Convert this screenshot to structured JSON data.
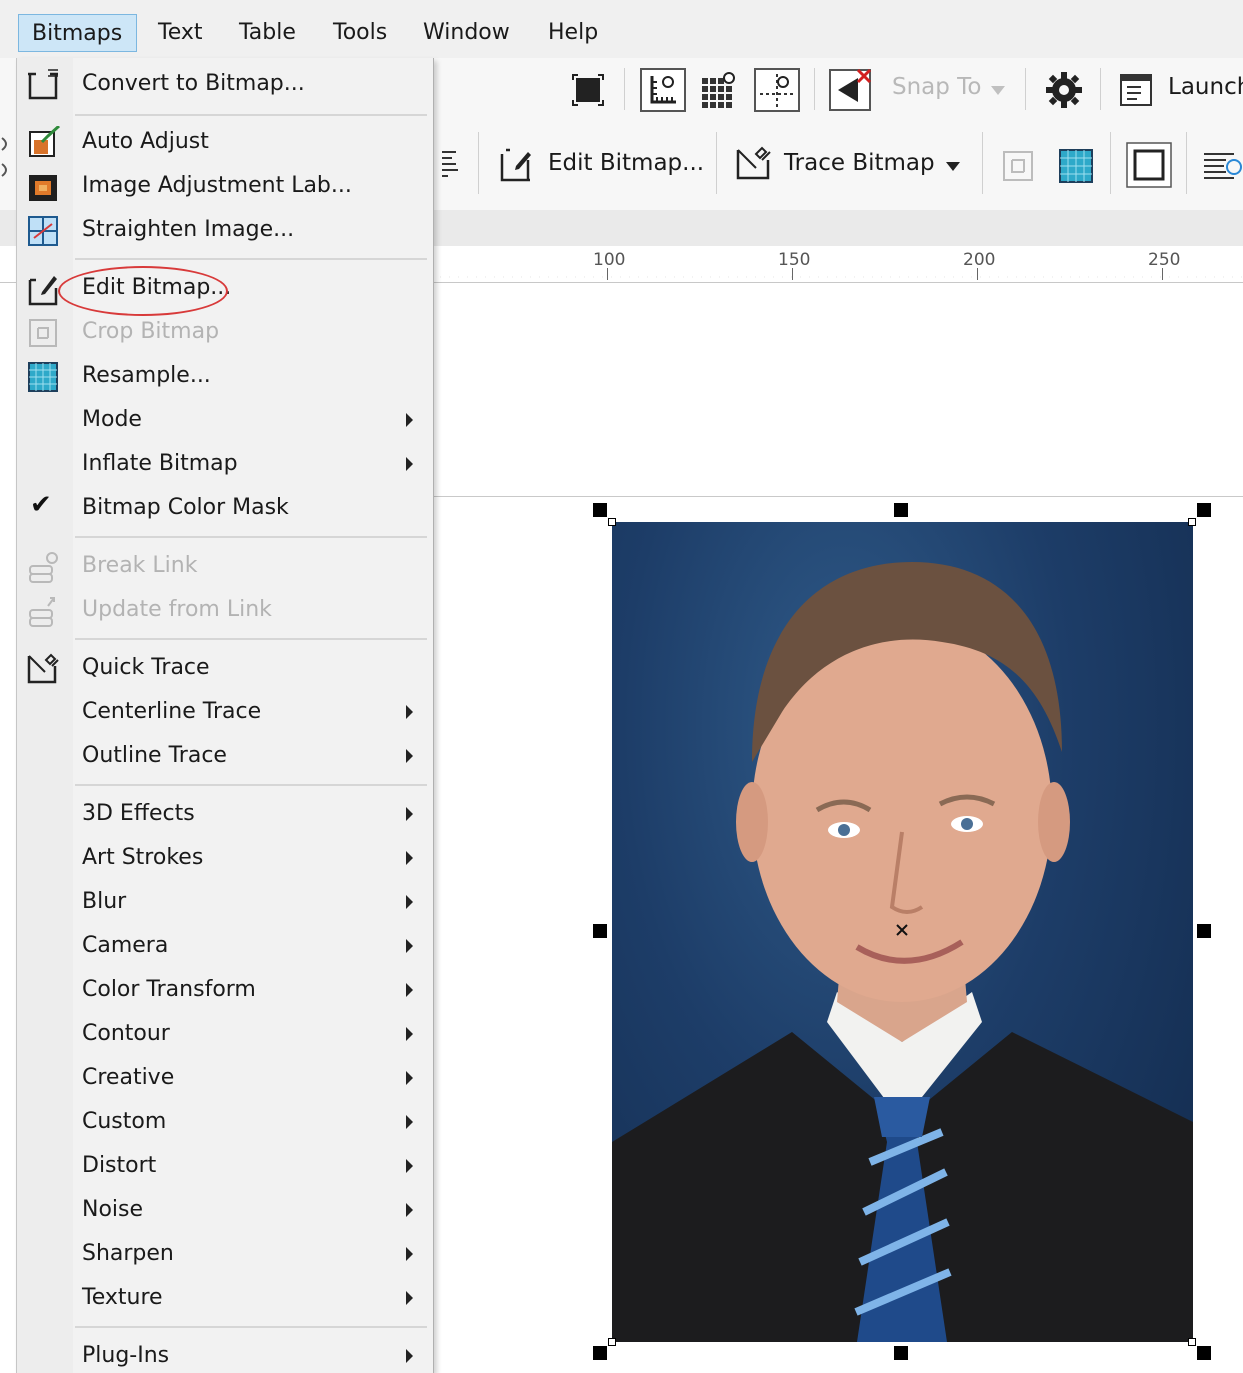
{
  "menubar": {
    "items": [
      "Bitmaps",
      "Text",
      "Table",
      "Tools",
      "Window",
      "Help"
    ]
  },
  "toolbar1": {
    "snap_label": "Snap To",
    "launch_label": "Launch"
  },
  "toolbar2": {
    "edit_bitmap_label": "Edit Bitmap...",
    "trace_bitmap_label": "Trace Bitmap"
  },
  "ruler": {
    "labels": [
      "100",
      "150",
      "200",
      "250"
    ]
  },
  "menu": {
    "convert": "Convert to Bitmap...",
    "auto_adjust": "Auto Adjust",
    "image_adjustment_lab": "Image Adjustment Lab...",
    "straighten": "Straighten Image...",
    "edit_bitmap": "Edit Bitmap...",
    "crop_bitmap": "Crop Bitmap",
    "resample": "Resample...",
    "mode": "Mode",
    "inflate_bitmap": "Inflate Bitmap",
    "color_mask": "Bitmap Color Mask",
    "break_link": "Break Link",
    "update_from_link": "Update from Link",
    "quick_trace": "Quick Trace",
    "centerline_trace": "Centerline Trace",
    "outline_trace": "Outline Trace",
    "effects": [
      "3D Effects",
      "Art Strokes",
      "Blur",
      "Camera",
      "Color Transform",
      "Contour",
      "Creative",
      "Custom",
      "Distort",
      "Noise",
      "Sharpen",
      "Texture"
    ],
    "plugins": "Plug-Ins"
  },
  "colors": {
    "highlight_oval": "#d83a3a",
    "menu_active": "#cde6f7",
    "selection_handles": "#000000"
  }
}
